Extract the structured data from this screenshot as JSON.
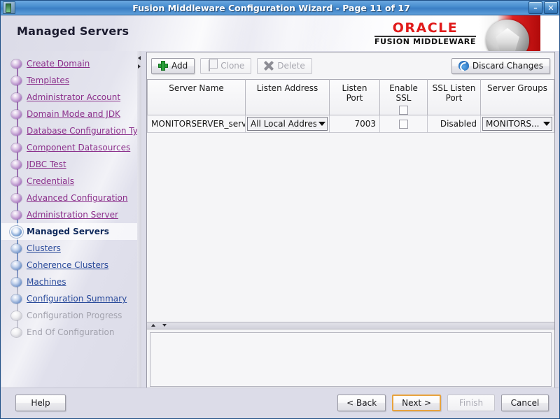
{
  "window": {
    "title": "Fusion Middleware Configuration Wizard - Page 11 of 17",
    "app_icon": "app-icon",
    "minimize_label": "–",
    "close_label": "✕"
  },
  "header": {
    "page_title": "Managed Servers",
    "brand": "ORACLE",
    "brand_sub": "FUSION MIDDLEWARE"
  },
  "sidebar": {
    "items": [
      {
        "label": "Create Domain",
        "state": "visited"
      },
      {
        "label": "Templates",
        "state": "visited"
      },
      {
        "label": "Administrator Account",
        "state": "visited"
      },
      {
        "label": "Domain Mode and JDK",
        "state": "visited"
      },
      {
        "label": "Database Configuration Type",
        "state": "visited"
      },
      {
        "label": "Component Datasources",
        "state": "visited"
      },
      {
        "label": "JDBC Test",
        "state": "visited"
      },
      {
        "label": "Credentials",
        "state": "visited"
      },
      {
        "label": "Advanced Configuration",
        "state": "visited"
      },
      {
        "label": "Administration Server",
        "state": "visited"
      },
      {
        "label": "Managed Servers",
        "state": "current"
      },
      {
        "label": "Clusters",
        "state": "link"
      },
      {
        "label": "Coherence Clusters",
        "state": "link"
      },
      {
        "label": "Machines",
        "state": "link"
      },
      {
        "label": "Configuration Summary",
        "state": "link"
      },
      {
        "label": "Configuration Progress",
        "state": "disabled"
      },
      {
        "label": "End Of Configuration",
        "state": "disabled"
      }
    ]
  },
  "toolbar": {
    "add_label": "Add",
    "clone_label": "Clone",
    "delete_label": "Delete",
    "discard_label": "Discard Changes",
    "add_icon": "plus-icon",
    "clone_icon": "copy-icon",
    "delete_icon": "x-icon",
    "discard_icon": "undo-icon"
  },
  "table": {
    "columns": [
      "Server Name",
      "Listen Address",
      "Listen Port",
      "Enable SSL",
      "SSL Listen Port",
      "Server Groups"
    ],
    "header_select_all_checkbox": "unchecked",
    "rows": [
      {
        "server_name": "MONITORSERVER_server",
        "listen_address": "All Local Address...",
        "listen_port": "7003",
        "enable_ssl": "unchecked",
        "ssl_listen_port": "Disabled",
        "server_groups": "MONITORS..."
      }
    ]
  },
  "footer": {
    "help_label": "Help",
    "back_label": "< Back",
    "next_label": "Next >",
    "finish_label": "Finish",
    "cancel_label": "Cancel"
  },
  "colors": {
    "titlebar_blue": "#3b7ec4",
    "oracle_red": "#e01a1a",
    "visited_link": "#8b2f8b",
    "link_blue": "#2a4b9b",
    "focus_orange": "#e8a33d",
    "panel_bg": "#f5f5f7",
    "sidebar_bg": "#dcdce8"
  }
}
